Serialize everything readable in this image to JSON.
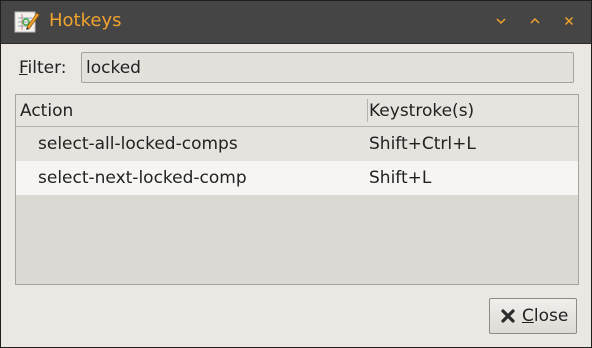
{
  "window": {
    "title": "Hotkeys",
    "icon": "app-editor-icon",
    "controls": [
      "minimize-icon",
      "maximize-icon",
      "close-window-icon"
    ],
    "accent_color": "#f0a22e"
  },
  "filter": {
    "label_mnemonic": "F",
    "label_rest": "ilter:",
    "value": "locked"
  },
  "table": {
    "columns": [
      "Action",
      "Keystroke(s)"
    ],
    "rows": [
      {
        "action": "select-all-locked-comps",
        "keystroke": "Shift+Ctrl+L"
      },
      {
        "action": "select-next-locked-comp",
        "keystroke": "Shift+L"
      }
    ]
  },
  "close_button": {
    "icon": "close-x-icon",
    "label_mnemonic": "C",
    "label_rest": "lose"
  }
}
